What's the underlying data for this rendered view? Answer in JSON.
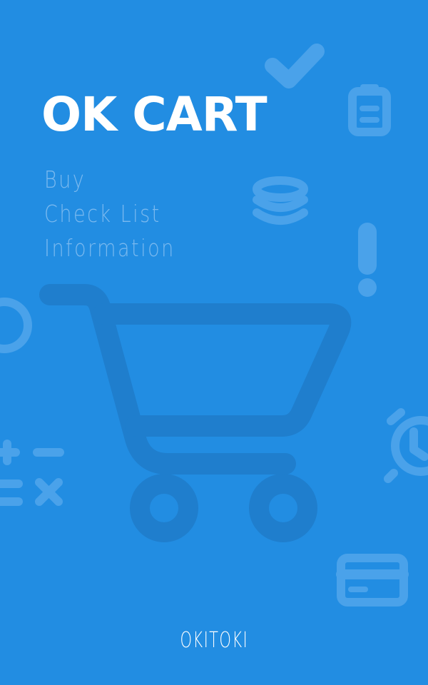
{
  "app": {
    "title": "OK CART",
    "brand": "OKITOKI"
  },
  "menu": {
    "items": [
      {
        "label": "Buy"
      },
      {
        "label": "Check List"
      },
      {
        "label": "Information"
      }
    ]
  },
  "colors": {
    "background": "#228de2",
    "icon_light": "#4aa2ea",
    "cart": "#1f7ecd",
    "subtitle": "#7ab9ef"
  },
  "icons": [
    "check-icon",
    "clipboard-icon",
    "coins-icon",
    "exclamation-icon",
    "circle-icon",
    "cart-icon",
    "calculator-icon",
    "alarm-clock-icon",
    "credit-card-icon"
  ]
}
